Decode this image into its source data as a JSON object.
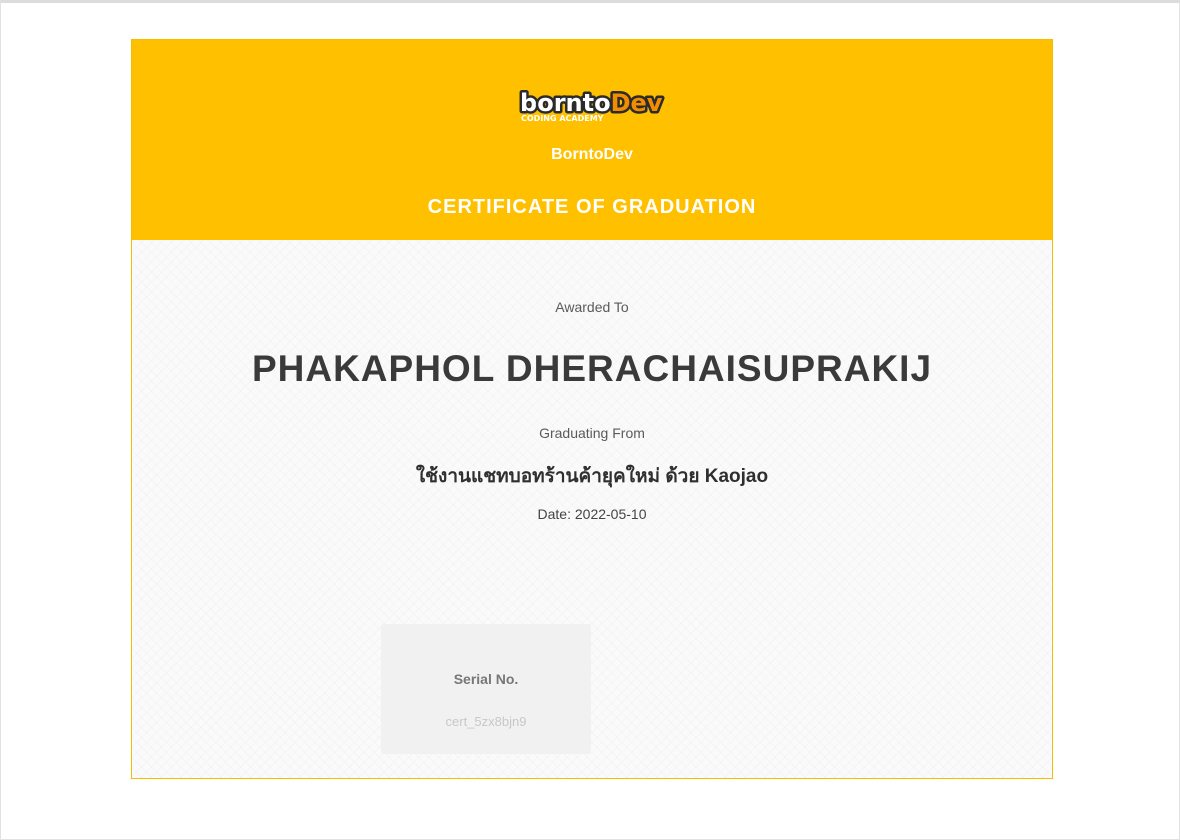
{
  "header": {
    "logo_text": "borntoDev",
    "logo_subtext": "CODING ACADEMY",
    "org_name": "BorntoDev",
    "title": "CERTIFICATE OF GRADUATION"
  },
  "body": {
    "awarded_label": "Awarded To",
    "recipient_name": "PHAKAPHOL DHERACHAISUPRAKIJ",
    "graduating_label": "Graduating From",
    "course_name": "ใช้งานแชทบอทร้านค้ายุคใหม่ ด้วย Kaojao",
    "date_line": "Date: 2022-05-10"
  },
  "serial": {
    "label": "Serial No.",
    "value": "cert_5zx8bjn9"
  },
  "colors": {
    "brand_yellow": "#ffc000",
    "logo_dark": "#2b2b2b",
    "logo_orange": "#f28c00"
  }
}
